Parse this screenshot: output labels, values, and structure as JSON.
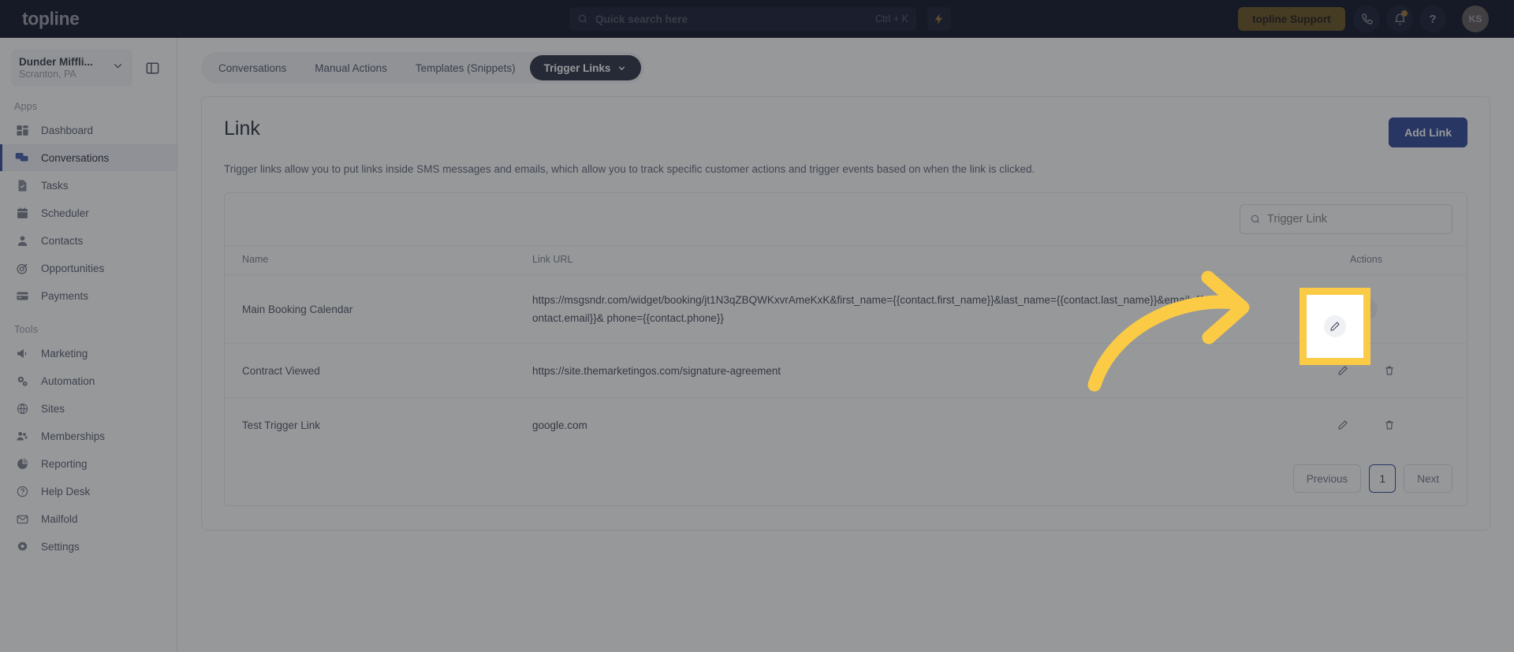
{
  "topbar": {
    "brand": "topline",
    "search": {
      "placeholder": "Quick search here",
      "shortcut": "Ctrl + K"
    },
    "bolt_icon": "lightning-bolt-icon",
    "support_label": "topline Support",
    "phone_icon": "phone-icon",
    "bell_icon": "bell-icon",
    "help_icon": "question-mark-icon",
    "avatar_initials": "KS",
    "accent": "#e2b33c",
    "support_bg": "#9a7314",
    "bar_bg": "#040b1e"
  },
  "sidebar": {
    "location_name": "Dunder Miffli...",
    "location_sub": "Scranton, PA",
    "chevron_icon": "chevron-down-icon",
    "panel_icon": "panel-toggle-icon",
    "sections": [
      {
        "label": "Apps",
        "items": [
          {
            "label": "Dashboard",
            "icon": "dashboard-icon",
            "active": false
          },
          {
            "label": "Conversations",
            "icon": "chat-bubbles-icon",
            "active": true
          },
          {
            "label": "Tasks",
            "icon": "task-check-icon",
            "active": false
          },
          {
            "label": "Scheduler",
            "icon": "calendar-icon",
            "active": false
          },
          {
            "label": "Contacts",
            "icon": "person-icon",
            "active": false
          },
          {
            "label": "Opportunities",
            "icon": "target-icon",
            "active": false
          },
          {
            "label": "Payments",
            "icon": "credit-card-icon",
            "active": false
          }
        ]
      },
      {
        "label": "Tools",
        "items": [
          {
            "label": "Marketing",
            "icon": "megaphone-icon",
            "active": false
          },
          {
            "label": "Automation",
            "icon": "gears-icon",
            "active": false
          },
          {
            "label": "Sites",
            "icon": "globe-icon",
            "active": false
          },
          {
            "label": "Memberships",
            "icon": "people-plus-icon",
            "active": false
          },
          {
            "label": "Reporting",
            "icon": "pie-chart-icon",
            "active": false
          },
          {
            "label": "Help Desk",
            "icon": "help-circle-icon",
            "active": false
          },
          {
            "label": "Mailfold",
            "icon": "mail-icon",
            "active": false
          },
          {
            "label": "Settings",
            "icon": "gear-icon",
            "active": false
          }
        ]
      }
    ]
  },
  "tabs": [
    {
      "label": "Conversations",
      "active": false,
      "chevron": false
    },
    {
      "label": "Manual Actions",
      "active": false,
      "chevron": false
    },
    {
      "label": "Templates (Snippets)",
      "active": false,
      "chevron": false
    },
    {
      "label": "Trigger Links",
      "active": true,
      "chevron": true
    }
  ],
  "page": {
    "title": "Link",
    "add_button": "Add Link",
    "description": "Trigger links allow you to put links inside SMS messages and emails, which allow you to track specific customer actions and trigger events based on when the link is clicked."
  },
  "table": {
    "search_placeholder": "Trigger Link",
    "search_value": "",
    "search_icon": "search-icon",
    "columns": [
      "Name",
      "Link URL",
      "Actions"
    ],
    "rows": [
      {
        "name": "Main Booking Calendar",
        "url": "https://msgsndr.com/widget/booking/jt1N3qZBQWKxvrAmeKxK&first_name={{contact.first_name}}&last_name={{contact.last_name}}&email={{contact.email}}& phone={{contact.phone}}",
        "edit_icon": "pencil-icon",
        "delete_icon": "trash-icon",
        "highlighted": true
      },
      {
        "name": "Contract Viewed",
        "url": "https://site.themarketingos.com/signature-agreement",
        "edit_icon": "pencil-icon",
        "delete_icon": "trash-icon",
        "highlighted": false
      },
      {
        "name": "Test Trigger Link",
        "url": "google.com",
        "edit_icon": "pencil-icon",
        "delete_icon": "trash-icon",
        "highlighted": false
      }
    ]
  },
  "pagination": {
    "previous": "Previous",
    "current": "1",
    "next": "Next"
  },
  "callout": {
    "arrow_color": "#fbcb46",
    "highlight_border": "#fbcb46"
  }
}
